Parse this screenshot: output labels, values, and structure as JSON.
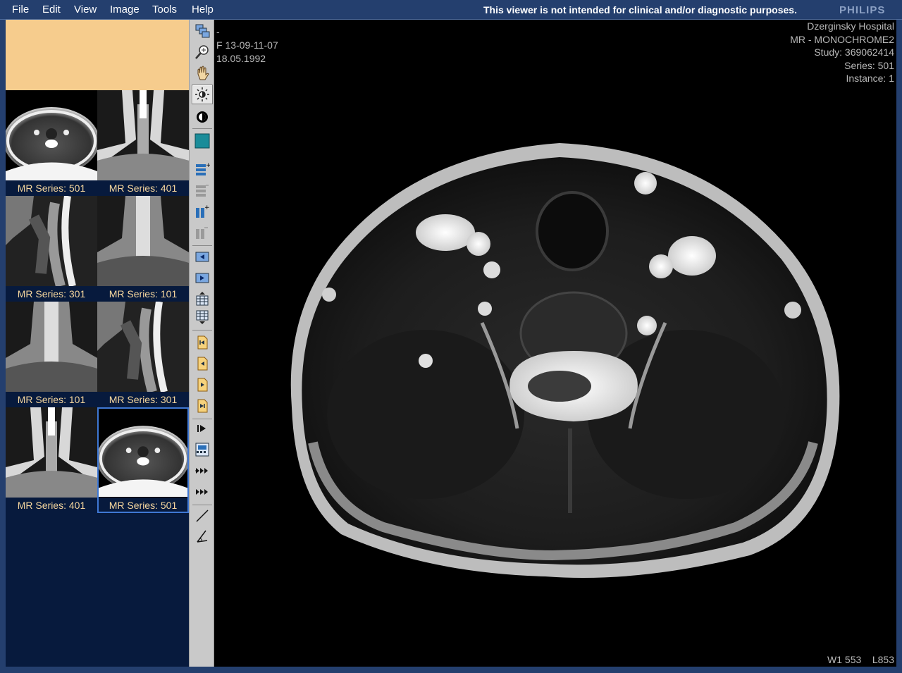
{
  "menu": {
    "items": [
      "File",
      "Edit",
      "View",
      "Image",
      "Tools",
      "Help"
    ],
    "notice": "This viewer is not intended for clinical and/or diagnostic purposes.",
    "brand": "PHILIPS"
  },
  "thumbnails": [
    {
      "label": "MR Series: 501",
      "view": "axial"
    },
    {
      "label": "MR Series: 401",
      "view": "coronal"
    },
    {
      "label": "MR Series: 301",
      "view": "sagittal"
    },
    {
      "label": "MR Series: 101",
      "view": "coronal"
    },
    {
      "label": "MR Series: 101",
      "view": "coronal"
    },
    {
      "label": "MR Series: 301",
      "view": "sagittal"
    },
    {
      "label": "MR Series: 401",
      "view": "coronal"
    },
    {
      "label": "MR Series: 501",
      "view": "axial",
      "selected": true
    }
  ],
  "toolbar": [
    "stack-icon",
    "zoom-icon",
    "pan-hand-icon",
    "window-level-icon",
    "invert-icon",
    "single-layout-icon",
    "add-rows-icon",
    "remove-rows-icon",
    "add-columns-icon",
    "remove-columns-icon",
    "previous-image-icon",
    "next-image-icon",
    "grid-up-icon",
    "grid-down-icon",
    "first-series-icon",
    "previous-series-icon",
    "next-series-icon",
    "last-series-icon",
    "play-icon",
    "cine-film-icon",
    "fast-forward-icon",
    "fast-forward-all-icon",
    "measure-line-icon",
    "measure-angle-icon"
  ],
  "overlay": {
    "top_left": [
      "-",
      "F 13-09-11-07",
      "18.05.1992"
    ],
    "top_right": [
      "Dzerginsky Hospital",
      "MR - MONOCHROME2",
      "Study: 369062414",
      "Series: 501",
      "Instance: 1"
    ],
    "bottom_right": "W1 553    L853"
  },
  "colors": {
    "frame": "#243f6e",
    "thumb_panel": "#071a3d",
    "info_box": "#f6cc8d",
    "thumb_label": "#f6d79e",
    "selection": "#3f78d4",
    "toolbar": "#c9c9c9"
  }
}
